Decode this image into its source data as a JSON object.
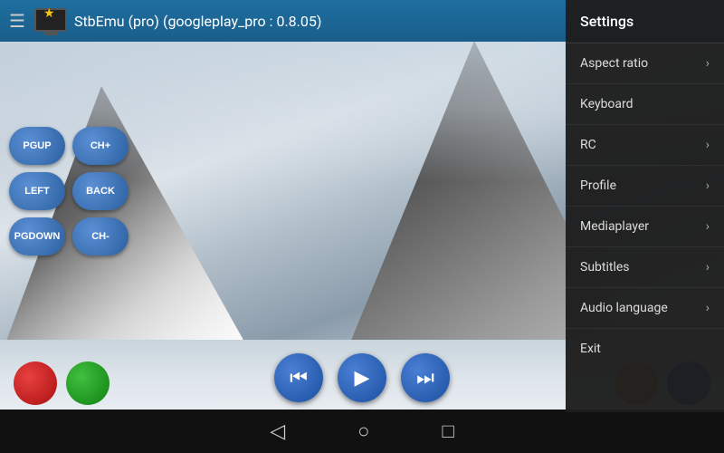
{
  "topbar": {
    "hamburger": "☰",
    "star": "★",
    "title": "StbEmu (pro) (googleplay_pro : 0.8.05)"
  },
  "controls": {
    "buttons": [
      [
        "PGUP",
        "CH+"
      ],
      [
        "LEFT",
        "BACK"
      ],
      [
        "PGDOWN",
        "CH-"
      ]
    ]
  },
  "transport": {
    "rewind": "⏮",
    "play": "▶",
    "fastforward": "⏭"
  },
  "menu": {
    "header": "Settings",
    "items": [
      {
        "label": "Aspect ratio",
        "hasArrow": true
      },
      {
        "label": "Keyboard",
        "hasArrow": false
      },
      {
        "label": "RC",
        "hasArrow": true
      },
      {
        "label": "Profile",
        "hasArrow": true
      },
      {
        "label": "Mediaplayer",
        "hasArrow": true
      },
      {
        "label": "Subtitles",
        "hasArrow": true
      },
      {
        "label": "Audio language",
        "hasArrow": true
      },
      {
        "label": "Exit",
        "hasArrow": false
      }
    ]
  },
  "navbar": {
    "back": "◁",
    "home": "○",
    "square": "□"
  }
}
